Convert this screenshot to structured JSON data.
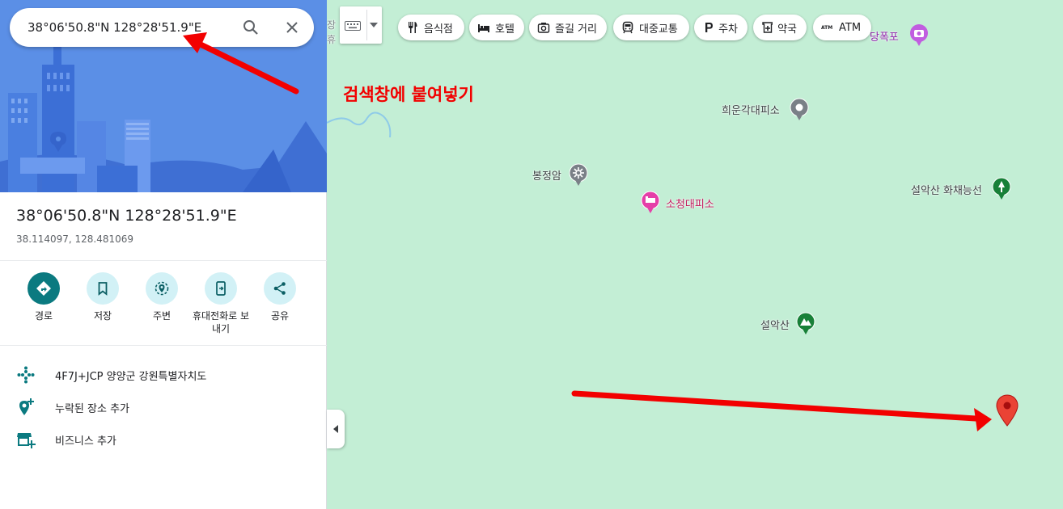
{
  "search": {
    "value": "38°06'50.8\"N 128°28'51.9\"E",
    "search_icon": "search-icon",
    "close_icon": "close-icon"
  },
  "place": {
    "title": "38°06'50.8\"N 128°28'51.9\"E",
    "coords": "38.114097, 128.481069"
  },
  "actions": [
    {
      "label": "경로",
      "icon": "directions-icon"
    },
    {
      "label": "저장",
      "icon": "bookmark-icon"
    },
    {
      "label": "주변",
      "icon": "nearby-icon"
    },
    {
      "label": "휴대전화로 보내기",
      "icon": "send-to-phone-icon"
    },
    {
      "label": "공유",
      "icon": "share-icon"
    }
  ],
  "info": [
    {
      "text": "4F7J+JCP 양양군 강원특별자치도",
      "icon": "plus-code-icon"
    },
    {
      "text": "누락된 장소 추가",
      "icon": "add-place-icon"
    },
    {
      "text": "비즈니스 추가",
      "icon": "add-business-icon"
    }
  ],
  "chips": [
    {
      "label": "음식점",
      "icon": "restaurant-icon"
    },
    {
      "label": "호텔",
      "icon": "hotel-icon"
    },
    {
      "label": "즐길 거리",
      "icon": "camera-icon"
    },
    {
      "label": "대중교통",
      "icon": "transit-icon"
    },
    {
      "label": "주차",
      "icon": "parking-icon"
    },
    {
      "label": "약국",
      "icon": "pharmacy-icon"
    },
    {
      "label": "ATM",
      "icon": "atm-icon"
    }
  ],
  "annotation": "검색창에 붙여넣기",
  "map_labels": {
    "waterfall": "당폭포",
    "shelter1": "희운각대피소",
    "temple": "봉정암",
    "shelter2": "소청대피소",
    "garden": "설악산 화채능선",
    "mountain": "설악산",
    "edge1": "장",
    "edge2": "휴"
  },
  "colors": {
    "map_bg": "#c3eed5",
    "accent": "#0b7a80",
    "annotation_red": "#f20000",
    "pin_red": "#ea4335"
  }
}
